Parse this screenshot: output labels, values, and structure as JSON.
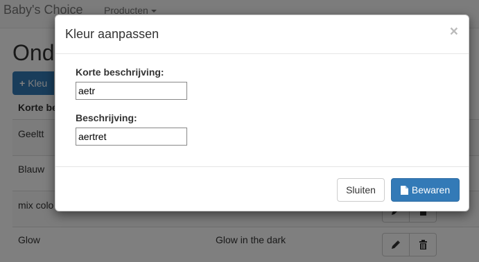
{
  "navbar": {
    "brand": "Baby's Choice",
    "products_menu": "Producten"
  },
  "page": {
    "title": "Onde",
    "add_button_label": "Kleu",
    "column_header": "Korte be"
  },
  "table": {
    "rows": [
      {
        "short": "Geeltt",
        "description": ""
      },
      {
        "short": "Blauw",
        "description": ""
      },
      {
        "short": "mix colo",
        "description": ""
      },
      {
        "short": "Glow",
        "description": "Glow in the dark"
      }
    ]
  },
  "modal": {
    "title": "Kleur aanpassen",
    "close_symbol": "×",
    "short_label": "Korte beschrijving:",
    "short_value": "aetr",
    "desc_label": "Beschrijving:",
    "desc_value": "aertret",
    "close_button": "Sluiten",
    "save_button": "Bewaren"
  },
  "icons": {
    "add": "plus-icon",
    "edit": "pencil-icon",
    "delete": "trash-icon",
    "save": "file-icon"
  },
  "colors": {
    "primary": "#337ab7",
    "backdrop": "rgba(0,0,0,0.5)"
  }
}
